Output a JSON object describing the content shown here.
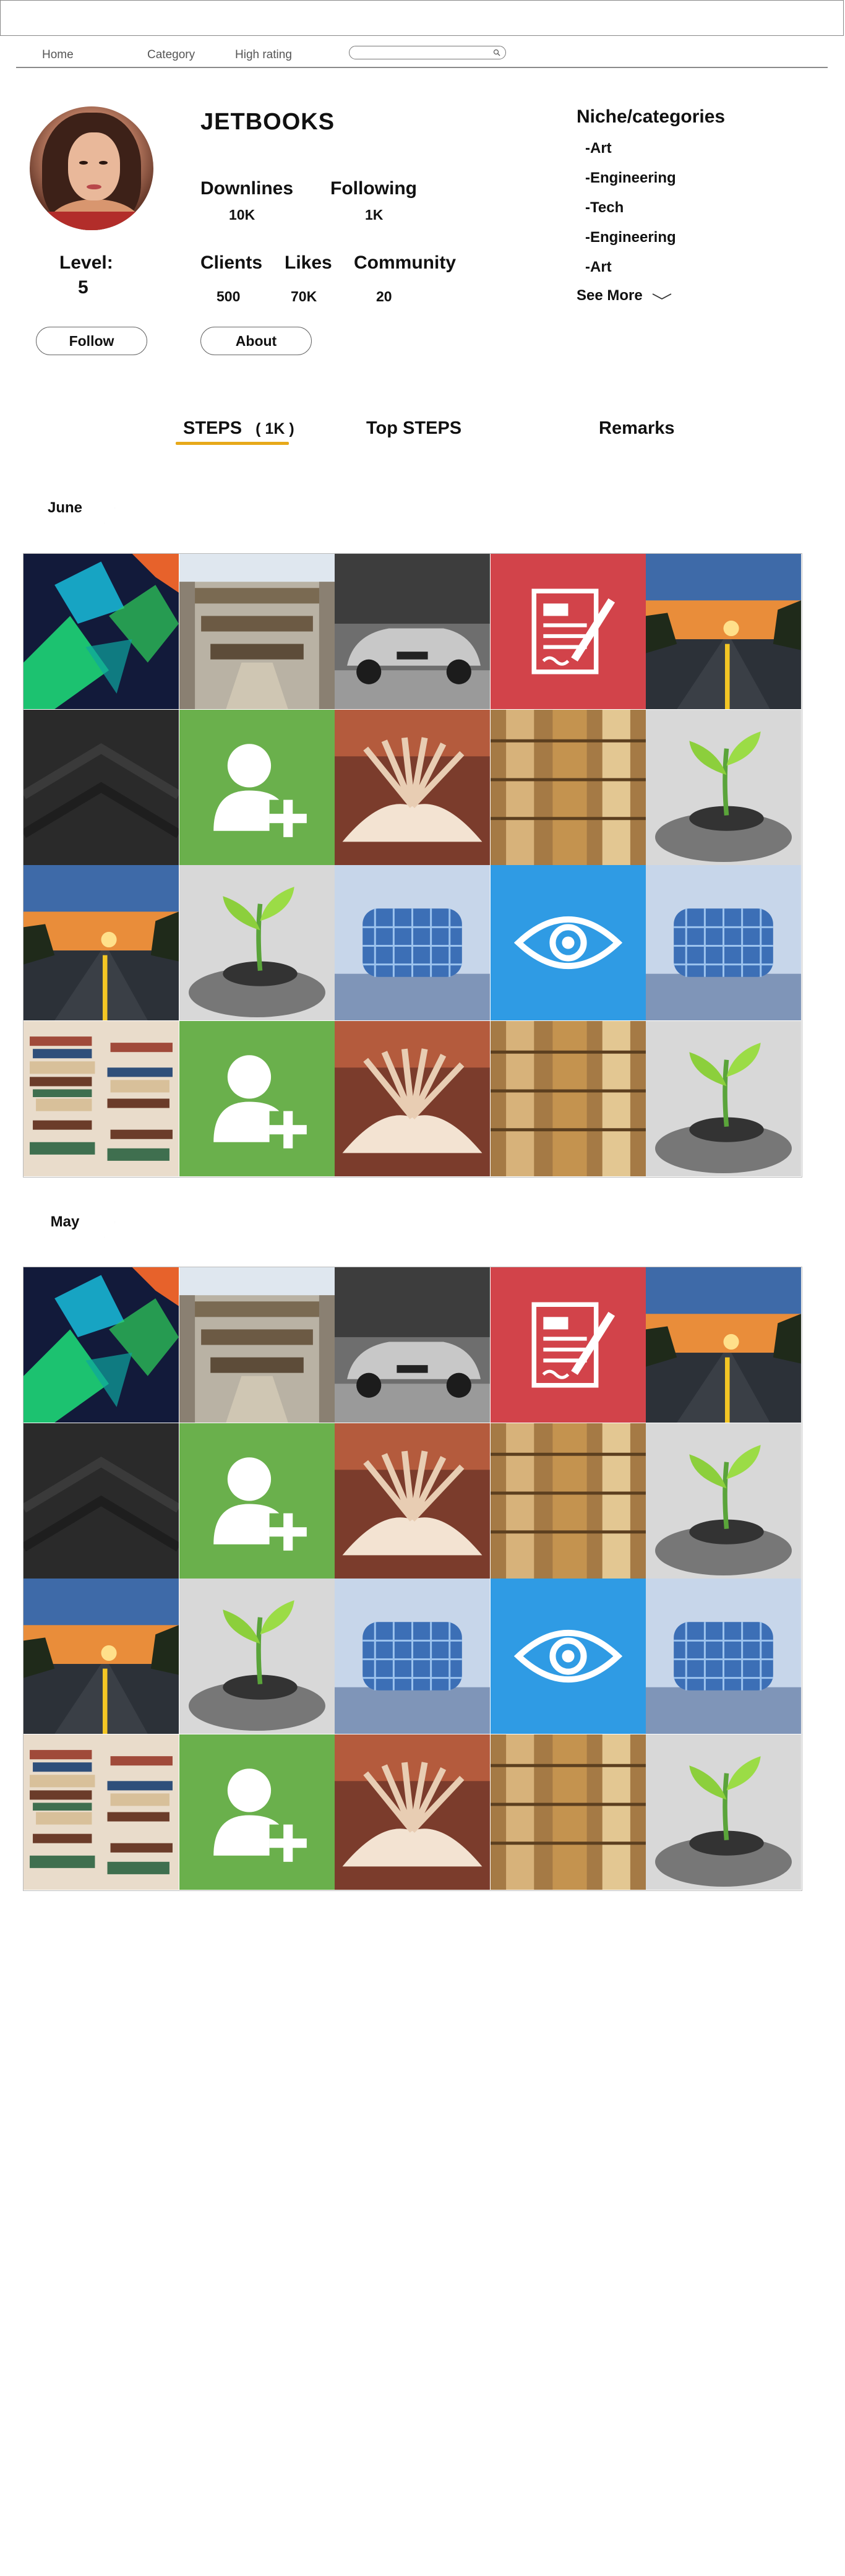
{
  "nav": {
    "items": [
      "Home",
      "Category",
      "High rating"
    ],
    "search_placeholder": ""
  },
  "profile": {
    "name": "JETBOOKS",
    "level_label": "Level:",
    "level_value": "5",
    "follow_label": "Follow",
    "about_label": "About",
    "stats": {
      "downlines": {
        "label": "Downlines",
        "value": "10K"
      },
      "following": {
        "label": "Following",
        "value": "1K"
      },
      "clients": {
        "label": "Clients",
        "value": "500"
      },
      "likes": {
        "label": "Likes",
        "value": "70K"
      },
      "community": {
        "label": "Community",
        "value": "20"
      }
    }
  },
  "niche": {
    "title": "Niche/categories",
    "items": [
      "-Art",
      "-Engineering",
      "-Tech",
      "-Engineering",
      "-Art"
    ],
    "see_more": "See More"
  },
  "tabs": [
    {
      "label": "STEPS",
      "count": "( 1K )",
      "active": true
    },
    {
      "label": "Top STEPS"
    },
    {
      "label": "Remarks"
    }
  ],
  "months": [
    "June",
    "May"
  ],
  "tile_rows": [
    [
      "abstract-art",
      "mall-interior",
      "sports-car",
      "document-icon",
      "sunset-road"
    ],
    [
      "dark-texture",
      "add-user-icon",
      "open-book",
      "bookshelf",
      "plant-in-hand"
    ],
    [
      "sunset-road",
      "plant-in-hand",
      "glass-building",
      "eye-icon",
      "glass-building"
    ],
    [
      "book-stacks",
      "add-user-icon",
      "open-book",
      "bookshelf",
      "plant-in-hand"
    ]
  ],
  "colors": {
    "accent_underline": "#e7a91a",
    "document_tile": "#d2434a",
    "add_user_tile": "#6ab04c",
    "eye_tile": "#2f9be4"
  }
}
